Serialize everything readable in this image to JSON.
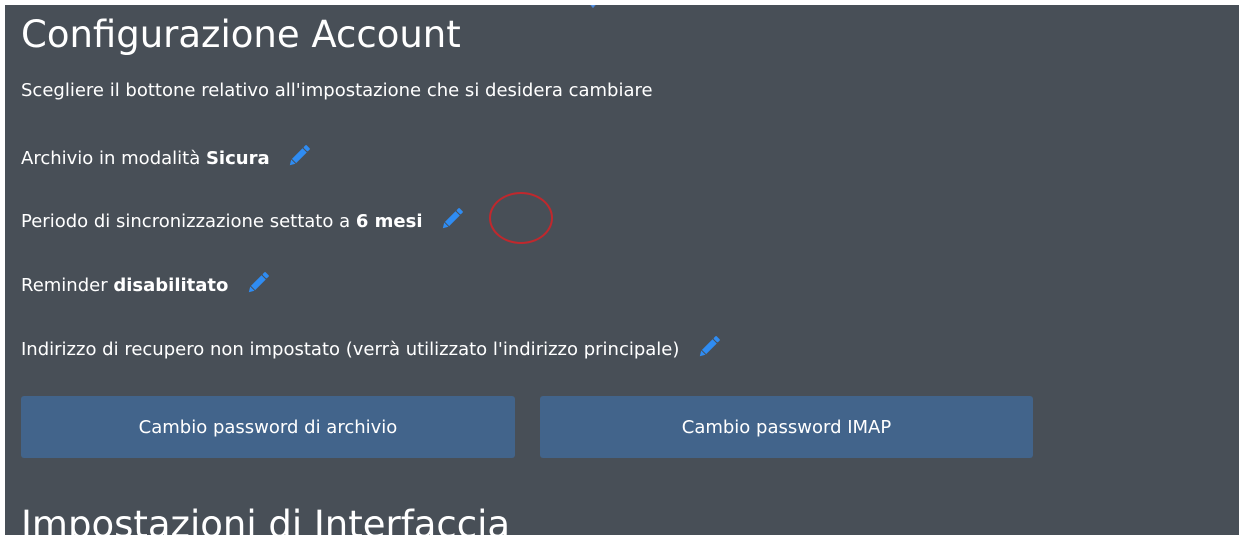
{
  "account": {
    "title": "Configurazione Account",
    "subtitle": "Scegliere il bottone relativo all'impostazione che si desidera cambiare",
    "archive_mode": {
      "prefix": "Archivio in modalità ",
      "value": "Sicura"
    },
    "sync_period": {
      "prefix": "Periodo di sincronizzazione settato a ",
      "value": "6 mesi"
    },
    "reminder": {
      "prefix": "Reminder ",
      "value": "disabilitato"
    },
    "recovery": {
      "text": "Indirizzo di recupero non impostato (verrà utilizzato l'indirizzo principale)"
    },
    "buttons": {
      "archive_password": "Cambio password di archivio",
      "imap_password": "Cambio password IMAP"
    }
  },
  "interface": {
    "title": "Impostazioni di Interfaccia"
  },
  "icons": {
    "edit": "pencil-icon",
    "marker": "chevron-down-icon"
  },
  "colors": {
    "panel_bg": "#484f57",
    "button_bg": "#42648b",
    "pencil": "#2f8cf2",
    "highlight": "#c0282d"
  }
}
